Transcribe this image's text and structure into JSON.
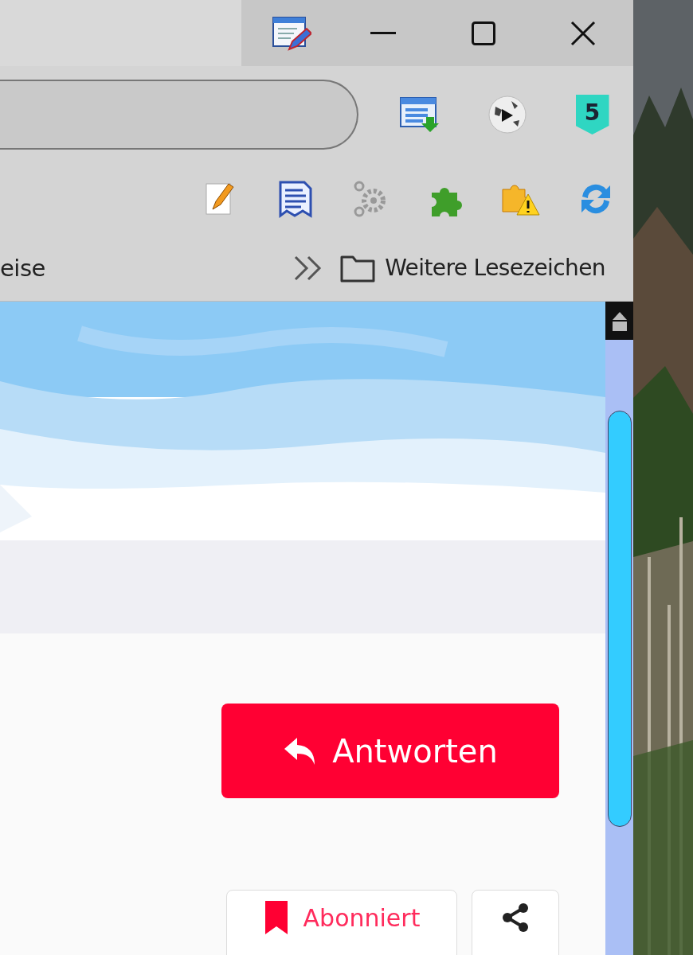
{
  "toolbar": {
    "extension_badge": "5"
  },
  "bookmarks_bar": {
    "cut_item": "eise",
    "folder": "Weitere Lesezeichen"
  },
  "post_actions": {
    "reply": "Antworten",
    "subscribe": "Abonniert"
  }
}
